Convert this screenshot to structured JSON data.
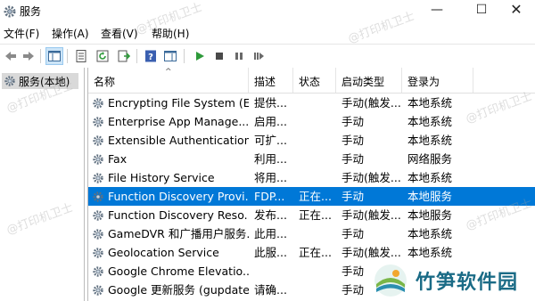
{
  "window": {
    "title": "服务",
    "min": "—",
    "max": "☐",
    "close": "✕"
  },
  "menu": [
    "文件(F)",
    "操作(A)",
    "查看(V)",
    "帮助(H)"
  ],
  "tree": {
    "root": "服务(本地)"
  },
  "columns": {
    "name": "名称",
    "desc": "描述",
    "status": "状态",
    "startup": "启动类型",
    "logon": "登录为"
  },
  "rows": [
    {
      "name": "Encrypting File System (E...",
      "desc": "提供...",
      "status": "",
      "startup": "手动(触发...",
      "logon": "本地系统"
    },
    {
      "name": "Enterprise App Manage...",
      "desc": "启用...",
      "status": "",
      "startup": "手动",
      "logon": "本地系统"
    },
    {
      "name": "Extensible Authentication...",
      "desc": "可扩...",
      "status": "",
      "startup": "手动",
      "logon": "本地系统"
    },
    {
      "name": "Fax",
      "desc": "利用...",
      "status": "",
      "startup": "手动",
      "logon": "网络服务"
    },
    {
      "name": "File History Service",
      "desc": "将用...",
      "status": "",
      "startup": "手动(触发...",
      "logon": "本地系统"
    },
    {
      "name": "Function Discovery Provi...",
      "desc": "FDP...",
      "status": "正在...",
      "startup": "手动",
      "logon": "本地服务"
    },
    {
      "name": "Function Discovery Reso...",
      "desc": "发布...",
      "status": "正在...",
      "startup": "手动(触发...",
      "logon": "本地服务"
    },
    {
      "name": "GameDVR 和广播用户服务...",
      "desc": "此用...",
      "status": "",
      "startup": "手动",
      "logon": "本地系统"
    },
    {
      "name": "Geolocation Service",
      "desc": "此服...",
      "status": "正在...",
      "startup": "手动(触发...",
      "logon": "本地系统"
    },
    {
      "name": "Google Chrome Elevatio...",
      "desc": "",
      "status": "",
      "startup": "手动",
      "logon": ""
    },
    {
      "name": "Google 更新服务 (gupdate)",
      "desc": "请确...",
      "status": "",
      "startup": "手动",
      "logon": ""
    }
  ],
  "selected_row": 5,
  "watermark": "@打印机卫士",
  "brand": {
    "text": "竹笋软件园"
  },
  "colors": {
    "selection": "#0078d7",
    "tree_selected": "#d9d9d9"
  }
}
